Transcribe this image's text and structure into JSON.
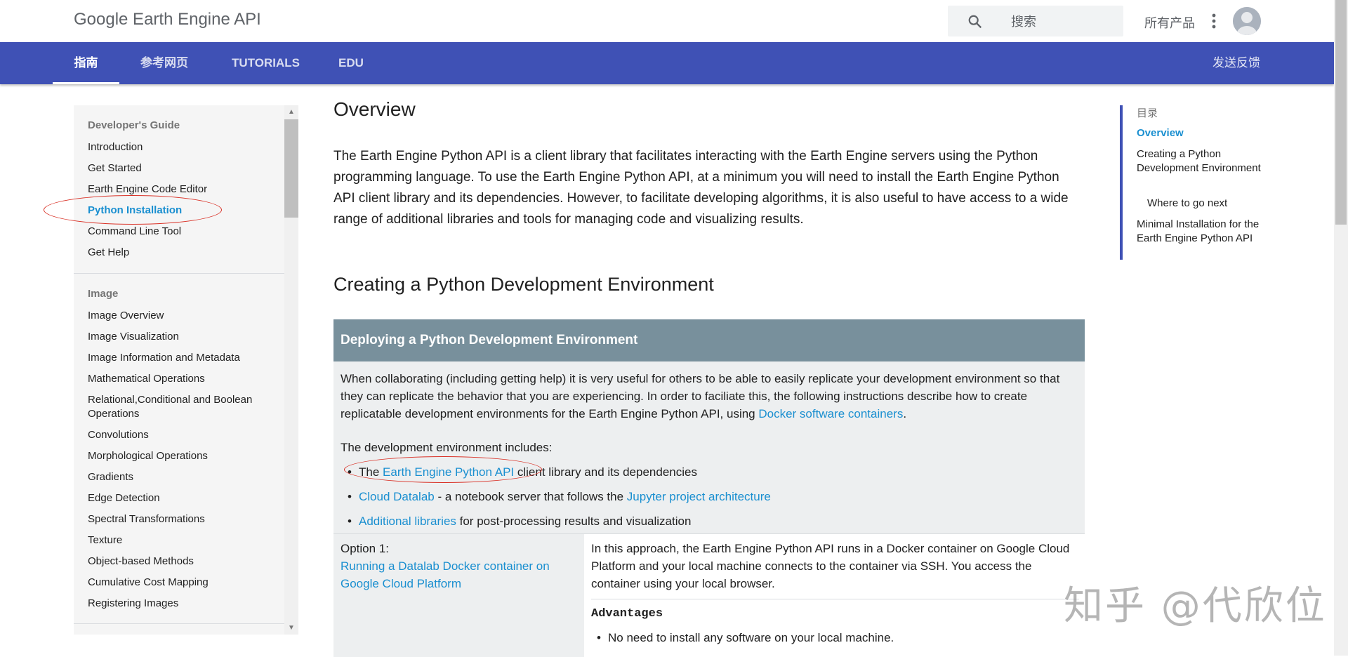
{
  "header": {
    "site_title": "Google Earth Engine API",
    "search_placeholder": "搜索",
    "all_products": "所有产品"
  },
  "nav": {
    "tabs": [
      "指南",
      "参考网页",
      "TUTORIALS",
      "EDU"
    ],
    "active_tab": "指南",
    "feedback": "发送反馈"
  },
  "sidebar": {
    "sections": [
      {
        "heading": "Developer's Guide",
        "items": [
          "Introduction",
          "Get Started",
          "Earth Engine Code Editor",
          "Python Installation",
          "Command Line Tool",
          "Get Help"
        ]
      },
      {
        "heading": "Image",
        "items": [
          "Image Overview",
          "Image Visualization",
          "Image Information and Metadata",
          "Mathematical Operations",
          "Relational,Conditional and Boolean Operations",
          "Convolutions",
          "Morphological Operations",
          "Gradients",
          "Edge Detection",
          "Spectral Transformations",
          "Texture",
          "Object-based Methods",
          "Cumulative Cost Mapping",
          "Registering Images"
        ]
      }
    ],
    "current_item": "Python Installation"
  },
  "main": {
    "title": "Overview",
    "intro": "The Earth Engine Python API is a client library that facilitates interacting with the Earth Engine servers using the Python programming language. To use the Earth Engine Python API, at a minimum you will need to install the Earth Engine Python API client library and its dependencies. However, to facilitate developing algorithms, it is also useful to have access to a wide range of additional libraries and tools for managing code and visualizing results.",
    "section_title": "Creating a Python Development Environment",
    "box": {
      "heading": "Deploying a Python Development Environment",
      "para1": "When collaborating (including getting help) it is very useful for others to be able to easily replicate your development environment so that they can replicate the behavior that you are experiencing. In order to faciliate this, the following instructions describe how to create replicatable development environments for the Earth Engine Python API, using ",
      "para1_link": "Docker software containers",
      "para1_end": ".",
      "includes": "The development environment includes:",
      "bullet1_pre": "The ",
      "bullet1_link": "Earth Engine Python API",
      "bullet1_post": " client library and its dependencies",
      "bullet2_link": "Cloud Datalab",
      "bullet2_mid": " - a notebook server that follows the ",
      "bullet2_link2": "Jupyter project architecture",
      "bullet3_link": "Additional libraries",
      "bullet3_post": " for post-processing results and visualization",
      "option_label": "Option 1:",
      "option_link": "Running a Datalab Docker container on Google Cloud Platform",
      "option_desc": "In this approach, the Earth Engine Python API runs in a Docker container on Google Cloud Platform and your local machine connects to the container via SSH. You access the container using your local browser.",
      "advantages": "Advantages",
      "adv1": "No need to install any software on your local machine."
    }
  },
  "toc": {
    "title": "目录",
    "items": [
      "Overview",
      "Creating a Python Development Environment",
      "Where to go next",
      "Minimal Installation for the Earth Engine Python API"
    ]
  },
  "watermark": "知乎 @代欣位",
  "colors": {
    "nav_blue": "#3f51b5",
    "link": "#1a8fd0",
    "box_header": "#78909c",
    "annotation_red": "#d93025"
  }
}
